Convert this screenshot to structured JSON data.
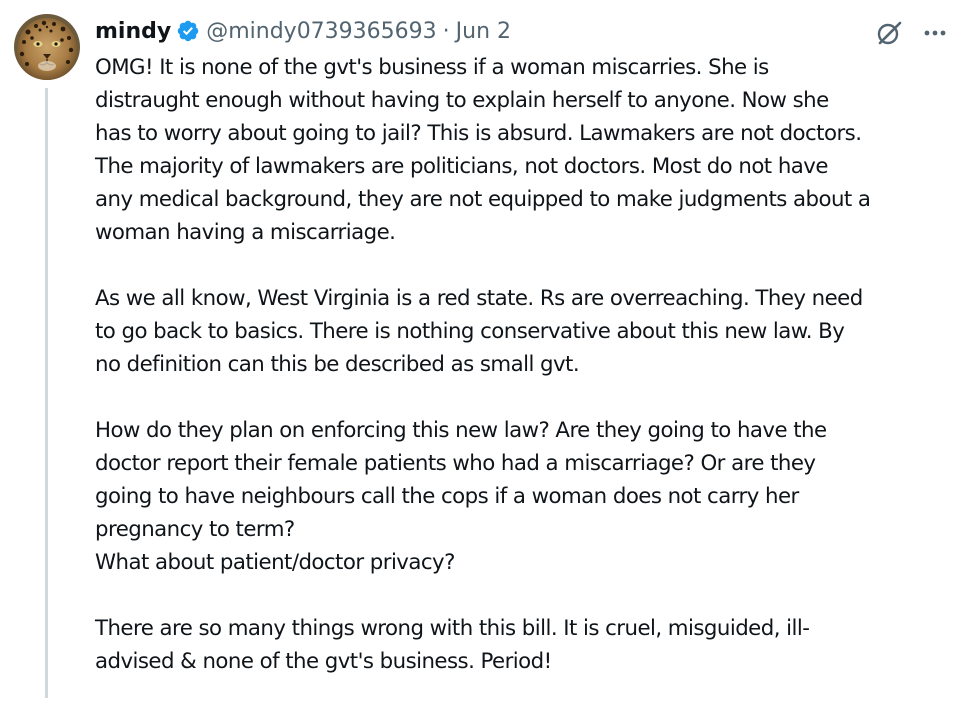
{
  "author": {
    "name": "mindy",
    "handle": "@mindy0739365693",
    "separator": "·",
    "date": "Jun 2",
    "avatar_icon": "leopard-avatar",
    "verified_icon": "verified-badge-icon",
    "verified_color": "#1d9bf0"
  },
  "actions": {
    "grok_icon": "grok-icon",
    "more_icon": "more-icon"
  },
  "colors": {
    "text": "#0f1419",
    "secondary": "#536471",
    "thread_line": "#cfd9de"
  },
  "tweet": {
    "paragraphs": [
      {
        "lines": [
          "OMG! It is none of the gvt's business if a woman miscarries. She is",
          "distraught enough without having to explain herself to anyone. Now she",
          "has to worry about going to jail? This is absurd. Lawmakers are not doctors.",
          "The majority of lawmakers are politicians, not doctors. Most do not have",
          "any medical background, they are not equipped to make judgments about a",
          "woman having a miscarriage."
        ]
      },
      {
        "lines": [
          "As we all know, West Virginia is a red state. Rs are overreaching.  They need",
          "to go back to basics. There is nothing conservative about this new law. By",
          "no definition can this be described as small gvt."
        ]
      },
      {
        "lines": [
          "How do they plan on enforcing this new law? Are they going to have the",
          "doctor report their female patients who had a miscarriage? Or are they",
          "going to have neighbours call the cops if a woman does not carry her",
          "pregnancy to term?",
          "What about patient/doctor privacy?"
        ]
      },
      {
        "lines": [
          "There are so many things wrong with this bill. It is cruel, misguided, ill-",
          "advised & none of the gvt's business. Period!"
        ]
      }
    ]
  }
}
